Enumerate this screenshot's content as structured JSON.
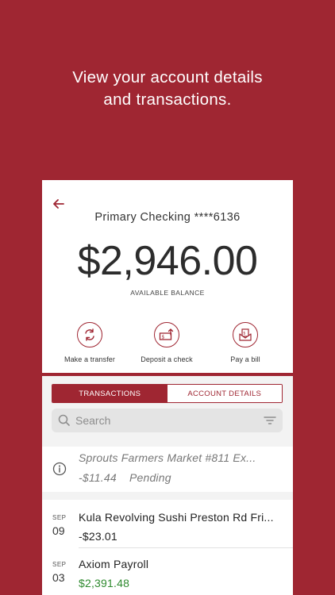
{
  "headline": {
    "line1": "View your account details",
    "line2": "and transactions."
  },
  "account": {
    "name": "Primary Checking ****6136",
    "balance": "$2,946.00",
    "balance_label": "AVAILABLE BALANCE"
  },
  "actions": [
    {
      "label": "Make a transfer",
      "icon": "transfer-icon"
    },
    {
      "label": "Deposit a check",
      "icon": "check-deposit-icon"
    },
    {
      "label": "Pay a bill",
      "icon": "bill-icon"
    }
  ],
  "tabs": {
    "transactions": "TRANSACTIONS",
    "account_details": "ACCOUNT DETAILS",
    "active": "transactions"
  },
  "search": {
    "placeholder": "Search",
    "value": ""
  },
  "pending": {
    "description": "Sprouts Farmers Market #811 Ex...",
    "amount": "-$11.44",
    "status": "Pending"
  },
  "transactions": [
    {
      "month": "SEP",
      "day": "09",
      "description": "Kula Revolving Sushi Preston Rd Fri...",
      "amount": "-$23.01",
      "type": "debit"
    },
    {
      "month": "SEP",
      "day": "03",
      "description": "Axiom Payroll",
      "amount": "$2,391.48",
      "type": "credit"
    }
  ],
  "colors": {
    "brand": "#9f2632",
    "credit": "#2e8a2e"
  }
}
